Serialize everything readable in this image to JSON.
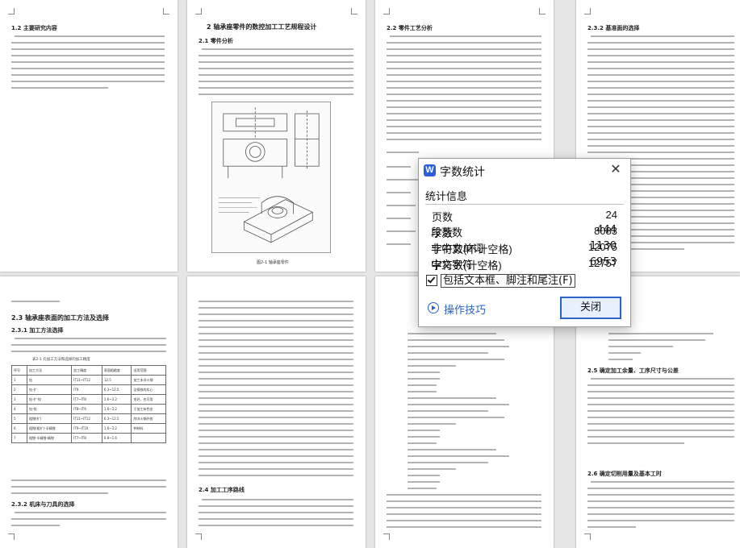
{
  "dialog": {
    "title": "字数统计",
    "section": "统计信息",
    "stats": [
      {
        "label": "页数",
        "value": "24"
      },
      {
        "label": "字数",
        "value": "8083"
      },
      {
        "label": "字符数(不计空格)",
        "value": "12075"
      },
      {
        "label": "字符数(计空格)",
        "value": "12757"
      },
      {
        "label": "段落数",
        "value": "444"
      },
      {
        "label": "非中文单词",
        "value": "1130"
      },
      {
        "label": "中文字符",
        "value": "6953"
      }
    ],
    "checkbox_label": "包括文本框、脚注和尾注(F)",
    "checkbox_checked": true,
    "help_link": "操作技巧",
    "close_button": "关闭",
    "logo_letter": "W"
  },
  "pages": {
    "p1_heading": "1.2 主要研究内容",
    "p2_title": "2 轴承座零件的数控加工工艺规程设计",
    "p2_sub": "2.1 零件分析",
    "p2_caption": "图2-1 轴承座零件",
    "p3_heading": "2.2 零件工艺分析",
    "p4_heading": "2.3.2 基准面的选择",
    "p5_heading": "2.3 轴承座表面的加工方法及选择",
    "p5_sub": "2.3.1 加工方法选择",
    "p5_table_caption": "表2-1 孔加工方法和选择的加工精度",
    "p5_sub2": "2.3.2 机床与刀具的选择",
    "p6_sub": "2.4 加工工序路线",
    "p8_heading1": "2.5 确定加工余量、工序尺寸与公差",
    "p8_heading2": "2.6 确定切削用量及基本工时"
  },
  "table": {
    "headers": [
      "序号",
      "加工方法",
      "加工精度",
      "表面粗糙度",
      "适用范围"
    ],
    "rows": [
      [
        "1",
        "钻",
        "IT11~IT12",
        "12.5",
        "加工未淬火钢"
      ],
      [
        "2",
        "钻-扩",
        "IT9",
        "6.3~12.5",
        "及铸铁的实心"
      ],
      [
        "3",
        "钻-扩-铰",
        "IT7~IT8",
        "1.6~3.2",
        "毛坯，也可用"
      ],
      [
        "4",
        "钻-铰",
        "IT8~IT9",
        "1.6~3.2",
        "于加工有色金"
      ],
      [
        "5",
        "粗镗(扩)",
        "IT11~IT12",
        "6.3~12.5",
        "除淬火钢外各"
      ],
      [
        "6",
        "粗镗(粗扩)-半精镗",
        "IT9~IT10",
        "1.6~3.2",
        "种材料"
      ],
      [
        "7",
        "粗镗-半精镗-精镗",
        "IT7~IT8",
        "0.8~1.6",
        ""
      ]
    ]
  },
  "colors": {
    "accent": "#2b63c9",
    "logo_bg": "#2b5fdc",
    "background": "#e6e6e6"
  }
}
